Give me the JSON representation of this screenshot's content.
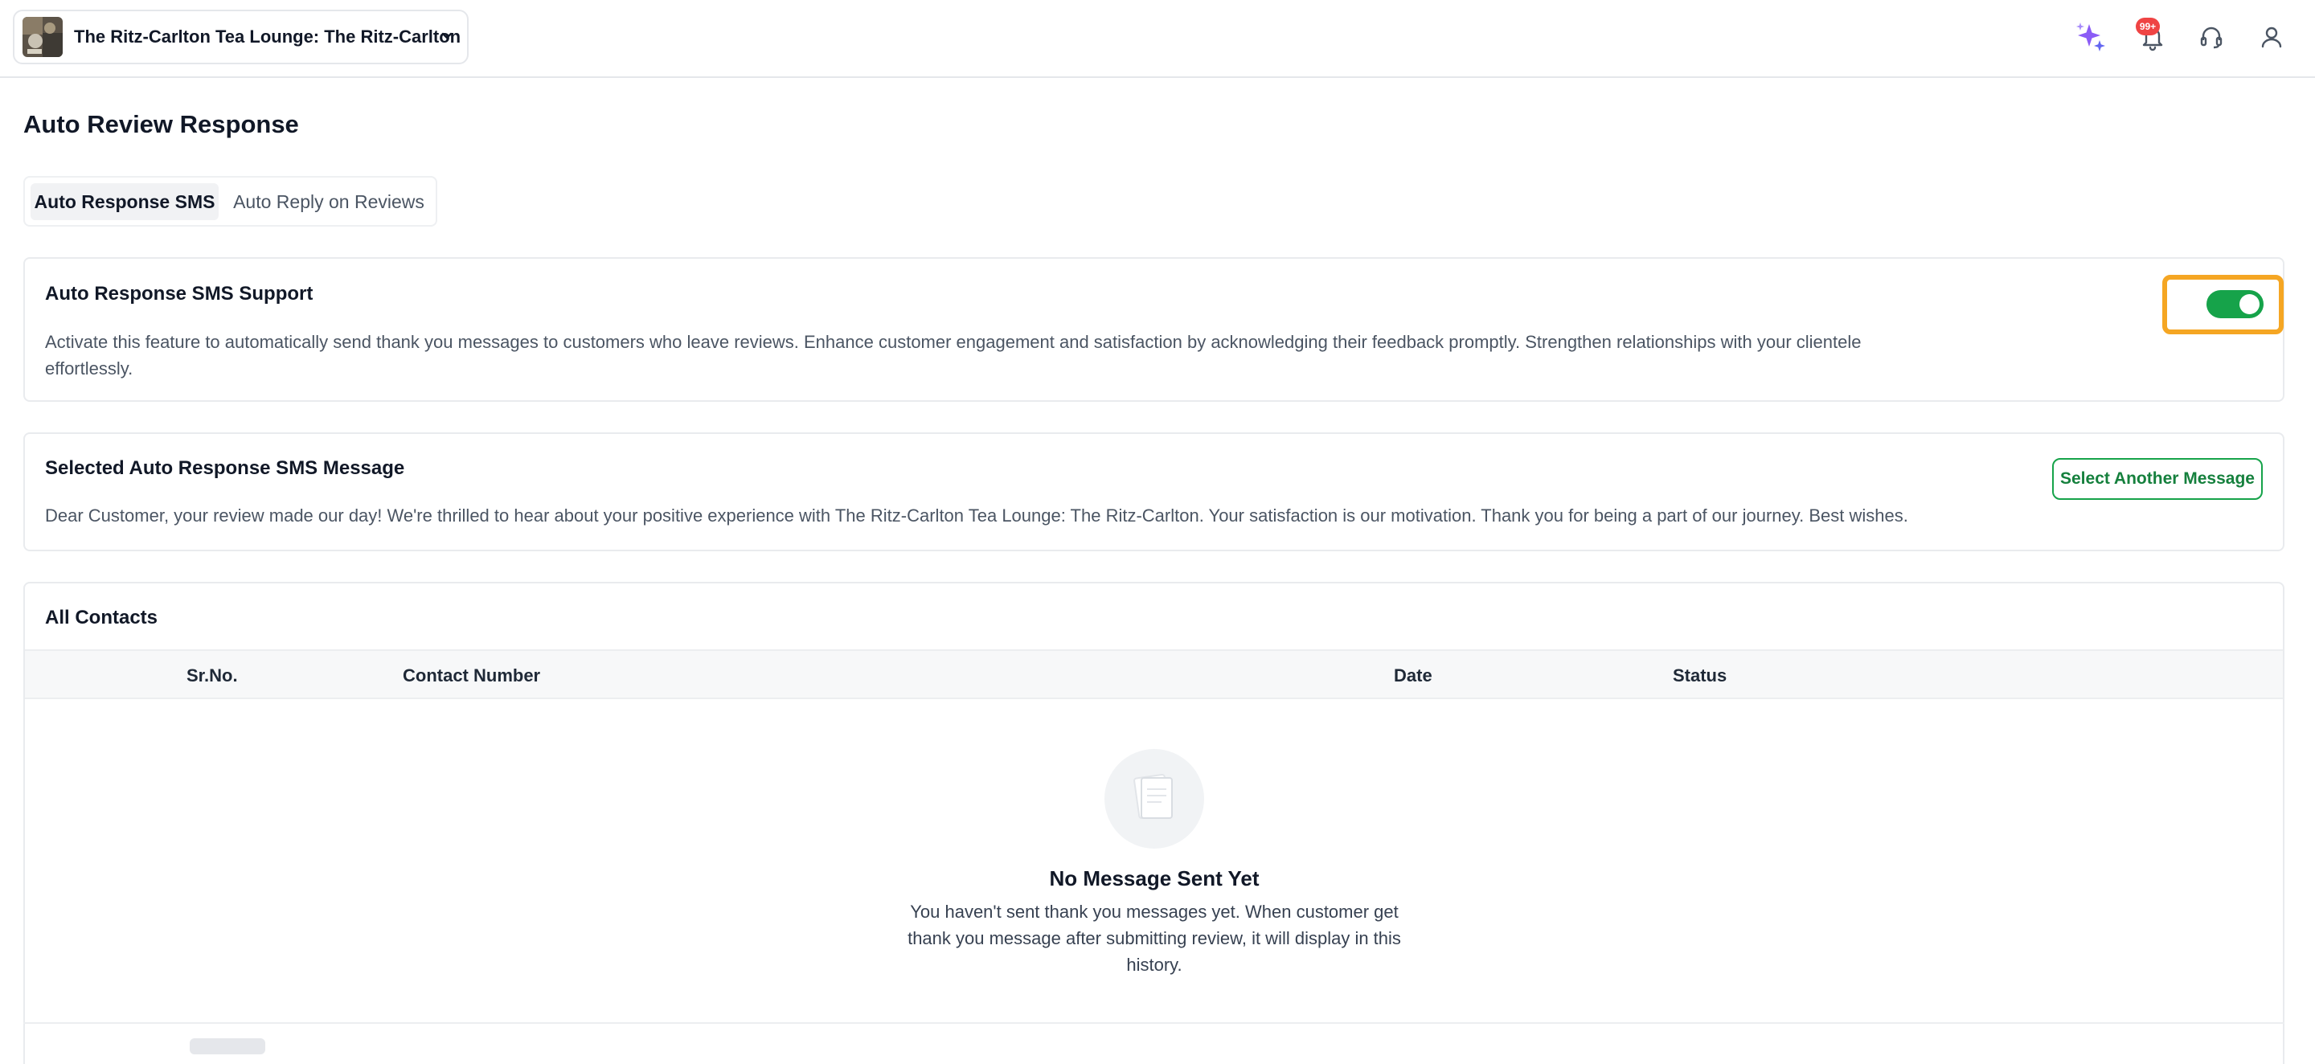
{
  "header": {
    "business_name": "The Ritz-Carlton Tea Lounge: The Ritz-Carlton",
    "notification_badge": "99+"
  },
  "page": {
    "title": "Auto Review Response"
  },
  "tabs": [
    {
      "label": "Auto Response SMS",
      "active": true
    },
    {
      "label": "Auto Reply on Reviews",
      "active": false
    }
  ],
  "sms_support": {
    "title": "Auto Response SMS Support",
    "description": "Activate this feature to automatically send thank you messages to customers who leave reviews. Enhance customer engagement and satisfaction by acknowledging their feedback promptly. Strengthen relationships with your clientele effortlessly.",
    "enabled": true
  },
  "selected_message": {
    "title": "Selected Auto Response SMS Message",
    "message": "Dear Customer, your review made our day! We're thrilled to hear about your positive experience with The Ritz-Carlton Tea Lounge: The Ritz-Carlton. Your satisfaction is our motivation. Thank you for being a part of our journey. Best wishes.",
    "button_label": "Select Another Message"
  },
  "contacts": {
    "title": "All Contacts",
    "columns": [
      "Sr.No.",
      "Contact Number",
      "Date",
      "Status"
    ],
    "rows": [],
    "empty_title": "No Message Sent Yet",
    "empty_description": "You haven't sent thank you messages yet. When customer get thank you message after submitting review, it will display in this history."
  },
  "colors": {
    "accent_green": "#16a34a",
    "highlight_orange": "#f5a623",
    "badge_red": "#ef4444",
    "sparkle_purple": "#8b5cf6"
  }
}
